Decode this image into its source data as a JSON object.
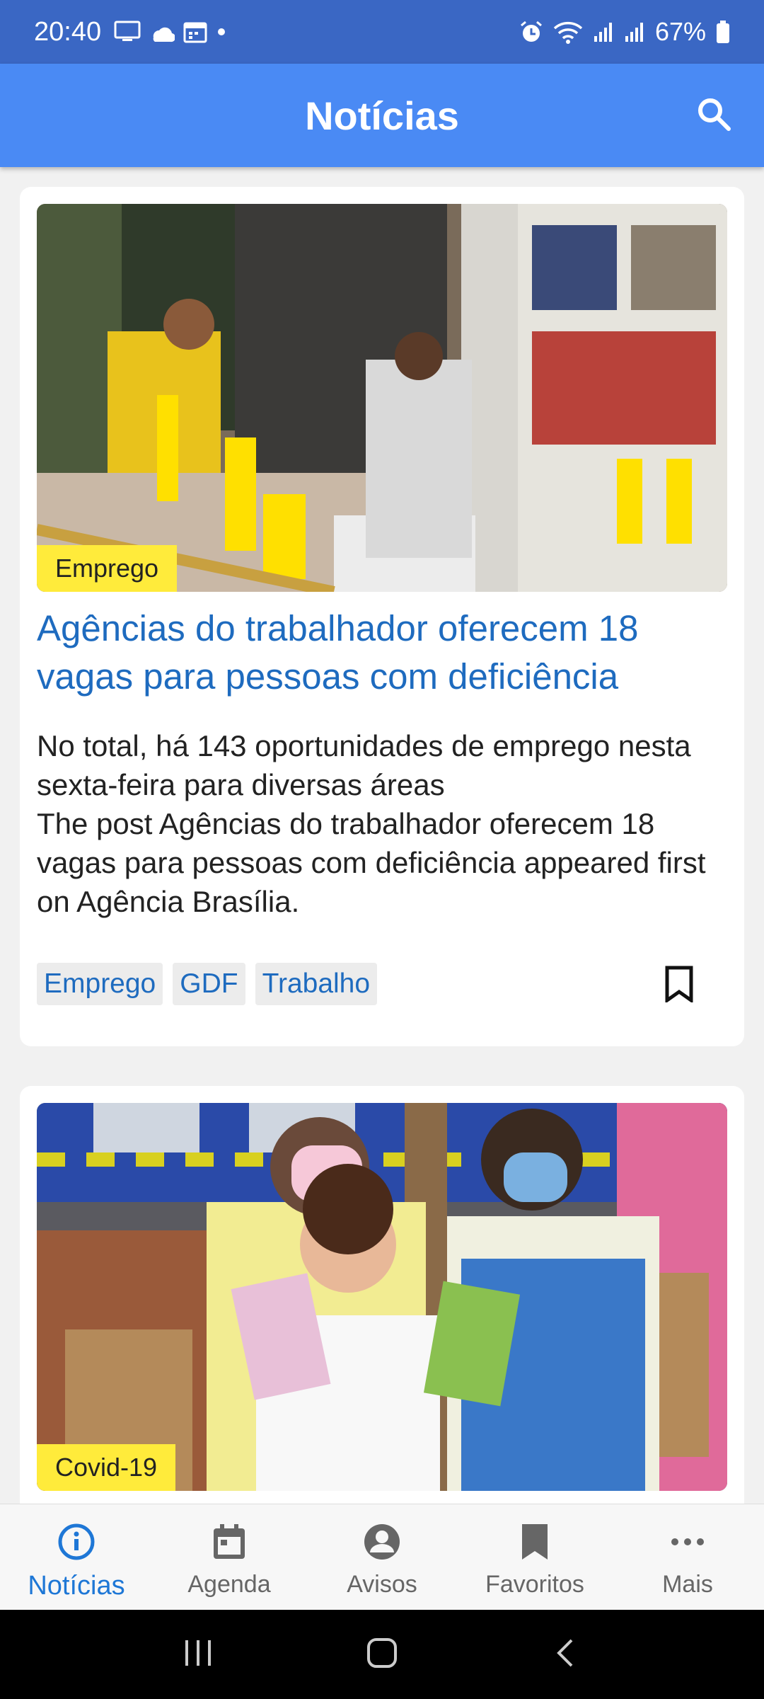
{
  "status_bar": {
    "time": "20:40",
    "battery": "67%"
  },
  "app_bar": {
    "title": "Notícias"
  },
  "articles": [
    {
      "category": "Emprego",
      "title": "Agências do trabalhador oferecem 18 vagas para pessoas com deficiência",
      "description": "No total, há 143 oportunidades de emprego nesta sexta-feira para diversas áreas\nThe post Agências do trabalhador oferecem 18 vagas para pessoas com deficiência appeared first on Agência Brasília.",
      "tags": [
        "Emprego",
        "GDF",
        "Trabalho"
      ]
    },
    {
      "category": "Covid-19"
    }
  ],
  "bottom_nav": {
    "items": [
      {
        "label": "Notícias",
        "icon": "info-icon",
        "active": true
      },
      {
        "label": "Agenda",
        "icon": "calendar-icon",
        "active": false
      },
      {
        "label": "Avisos",
        "icon": "account-circle-icon",
        "active": false
      },
      {
        "label": "Favoritos",
        "icon": "bookmark-icon",
        "active": false
      },
      {
        "label": "Mais",
        "icon": "more-horiz-icon",
        "active": false
      }
    ]
  },
  "colors": {
    "status_bar": "#3a67c4",
    "app_bar": "#4a8af4",
    "link_blue": "#1e6bbf",
    "category_yellow": "#ffeb3b",
    "active_nav": "#1e77d6"
  }
}
